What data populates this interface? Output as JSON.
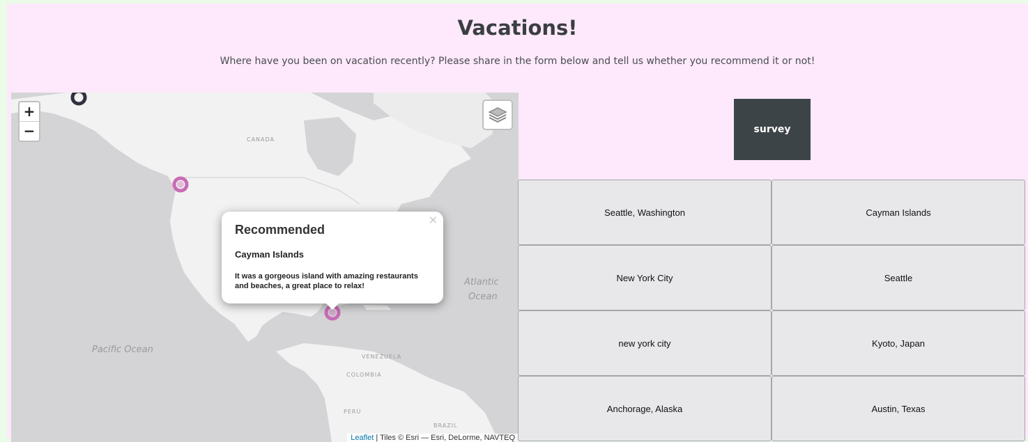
{
  "header": {
    "title": "Vacations!",
    "subtitle": "Where have you been on vacation recently? Please share in the form below and tell us whether you recommend it or not!"
  },
  "map": {
    "zoom_in": "+",
    "zoom_out": "−",
    "labels": {
      "canada": "CANADA",
      "atlantic_1": "Atlantic",
      "atlantic_2": "Ocean",
      "pacific": "Pacific Ocean",
      "venezuela": "VENEZUELA",
      "colombia": "COLOMBIA",
      "peru": "PERÚ",
      "brazil": "BRAZIL"
    },
    "popup": {
      "close": "×",
      "heading": "Recommended",
      "place": "Cayman Islands",
      "text": "It was a gorgeous island with amazing restaurants and beaches, a great place to relax!"
    },
    "attribution": {
      "leaflet": "Leaflet",
      "tiles": " | Tiles © Esri — Esri, DeLorme, NAVTEQ"
    },
    "marker_colors": {
      "recommended": "#c86cb5",
      "not_recommended": "#2f3140"
    }
  },
  "survey": {
    "label": "survey"
  },
  "entries": [
    "Seattle, Washington",
    "Cayman Islands",
    "New York City",
    "Seattle",
    "new york city",
    "Kyoto, Japan",
    "Anchorage, Alaska",
    "Austin, Texas"
  ]
}
